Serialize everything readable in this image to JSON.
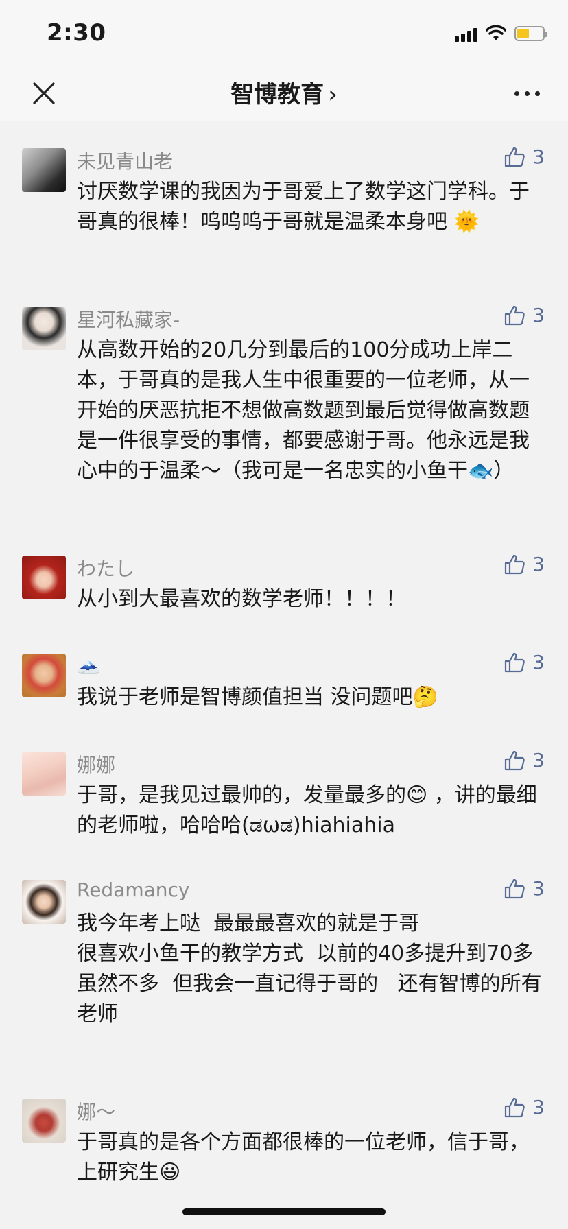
{
  "status_bar": {
    "time": "2:30"
  },
  "nav": {
    "title": "智博教育",
    "chevron": "›"
  },
  "comments": [
    {
      "name": "未见青山老",
      "likes": "3",
      "text": "讨厌数学课的我因为于哥爱上了数学这门学科。于哥真的很棒！呜呜呜于哥就是温柔本身吧 🌞"
    },
    {
      "name": "星河私藏家-",
      "likes": "3",
      "text": "从高数开始的20几分到最后的100分成功上岸二本，于哥真的是我人生中很重要的一位老师，从一开始的厌恶抗拒不想做高数题到最后觉得做高数题是一件很享受的事情，都要感谢于哥。他永远是我心中的于温柔～（我可是一名忠实的小鱼干🐟）"
    },
    {
      "name": "わたし",
      "likes": "3",
      "text": "从小到大最喜欢的数学老师！！！！"
    },
    {
      "name": "🗻",
      "likes": "3",
      "text": "我说于老师是智博颜值担当 没问题吧🤔"
    },
    {
      "name": "娜娜",
      "likes": "3",
      "text": "于哥，是我见过最帅的，发量最多的😊 ，讲的最细的老师啦，哈哈哈(ಡωಡ)hiahiahia"
    },
    {
      "name": "Redamancy",
      "likes": "3",
      "text": "我今年考上哒  最最最喜欢的就是于哥\n很喜欢小鱼干的教学方式  以前的40多提升到70多\n虽然不多  但我会一直记得于哥的   还有智博的所有老师"
    },
    {
      "name": "娜～",
      "likes": "3",
      "text": "于哥真的是各个方面都很棒的一位老师，信于哥，上研究生😃"
    }
  ]
}
